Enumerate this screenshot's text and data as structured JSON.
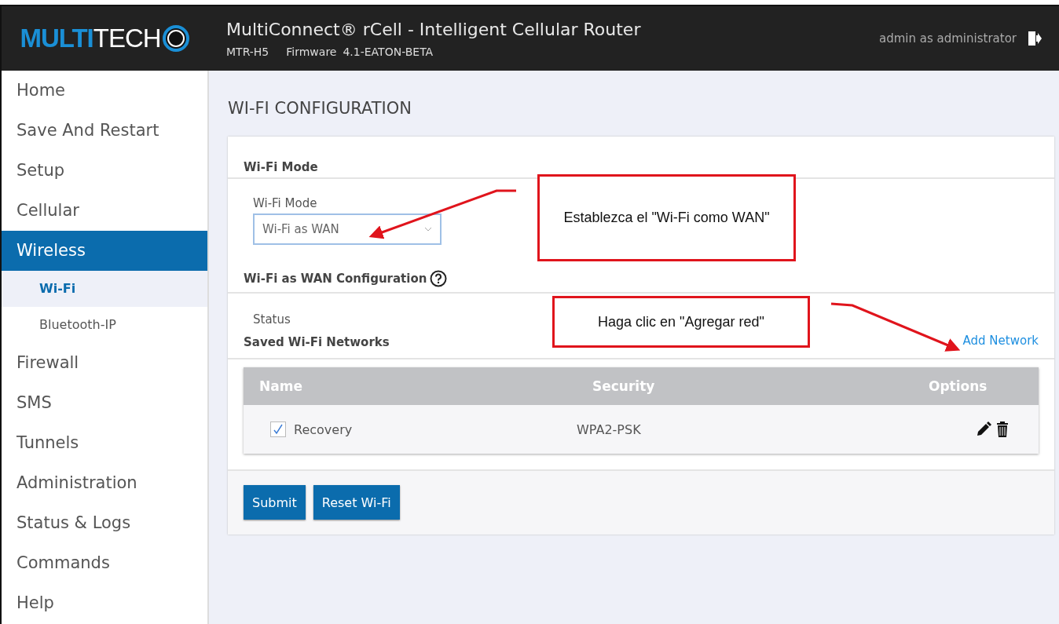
{
  "header": {
    "logo_bold": "MULTI",
    "logo_light": "TECH",
    "title": "MultiConnect® rCell - Intelligent Cellular Router",
    "model": "MTR-H5",
    "firmware_label": "Firmware",
    "firmware": "4.1-EATON-BETA",
    "user": "admin as administrator"
  },
  "sidebar": {
    "items": [
      {
        "label": "Home",
        "selected": false
      },
      {
        "label": "Save And Restart",
        "selected": false
      },
      {
        "label": "Setup",
        "selected": false
      },
      {
        "label": "Cellular",
        "selected": false
      },
      {
        "label": "Wireless",
        "selected": true,
        "children": [
          {
            "label": "Wi-Fi",
            "selected": true
          },
          {
            "label": "Bluetooth-IP",
            "selected": false
          }
        ]
      },
      {
        "label": "Firewall",
        "selected": false
      },
      {
        "label": "SMS",
        "selected": false
      },
      {
        "label": "Tunnels",
        "selected": false
      },
      {
        "label": "Administration",
        "selected": false
      },
      {
        "label": "Status & Logs",
        "selected": false
      },
      {
        "label": "Commands",
        "selected": false
      },
      {
        "label": "Help",
        "selected": false
      }
    ]
  },
  "page_title": "WI-FI CONFIGURATION",
  "mode_section": {
    "title": "Wi-Fi Mode",
    "field_label": "Wi-Fi Mode",
    "value": "Wi-Fi as WAN"
  },
  "wan_section": {
    "title": "Wi-Fi as WAN Configuration",
    "status_label": "Status"
  },
  "networks_section": {
    "title": "Saved Wi-Fi Networks",
    "add_link": "Add Network",
    "columns": [
      "Name",
      "Security",
      "Options"
    ],
    "rows": [
      {
        "checked": true,
        "name": "Recovery",
        "security": "WPA2-PSK"
      }
    ]
  },
  "buttons": [
    "Submit",
    "Reset Wi-Fi"
  ],
  "annotations": [
    {
      "text": "Establezca el \"Wi-Fi como WAN\""
    },
    {
      "text": "Haga clic en \"Agregar red\""
    }
  ]
}
